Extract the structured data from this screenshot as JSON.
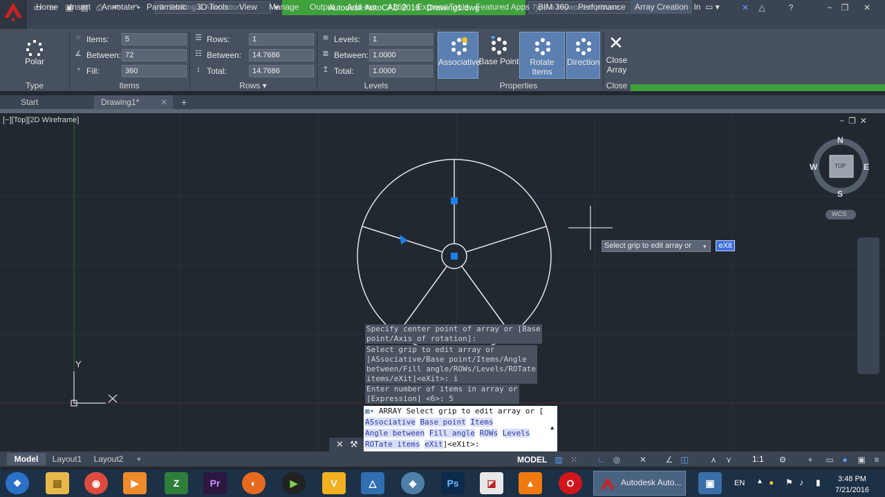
{
  "title_bar": {
    "workspace": "Drafting & Annotation",
    "app_title": "Autodesk AutoCAD 2016",
    "file_name": "Drawing1.dwg",
    "search_placeholder": "Type a keyword or phrase",
    "sign_in": "Sign In"
  },
  "ribbon_tabs": [
    "Home",
    "Insert",
    "Annotate",
    "Parametric",
    "3D Tools",
    "View",
    "Manage",
    "Output",
    "Add-ins",
    "A360",
    "Express Tools",
    "Featured Apps",
    "BIM 360",
    "Performance",
    "Array Creation"
  ],
  "ribbon": {
    "type_panel": {
      "title": "Type",
      "button": "Polar"
    },
    "items_panel": {
      "title": "Items",
      "fields": [
        {
          "label": "Items:",
          "value": "5"
        },
        {
          "label": "Between:",
          "value": "72"
        },
        {
          "label": "Fill:",
          "value": "360"
        }
      ]
    },
    "rows_panel": {
      "title": "Rows",
      "fields": [
        {
          "label": "Rows:",
          "value": "1"
        },
        {
          "label": "Between:",
          "value": "14.7686"
        },
        {
          "label": "Total:",
          "value": "14.7686"
        }
      ]
    },
    "levels_panel": {
      "title": "Levels",
      "fields": [
        {
          "label": "Levels:",
          "value": "1"
        },
        {
          "label": "Between:",
          "value": "1.0000"
        },
        {
          "label": "Total:",
          "value": "1.0000"
        }
      ]
    },
    "properties_panel": {
      "title": "Properties",
      "buttons": [
        "Associative",
        "Base Point",
        "Rotate Items",
        "Direction"
      ]
    },
    "close_panel": {
      "title": "Close",
      "button_line1": "Close",
      "button_line2": "Array"
    }
  },
  "file_tabs": {
    "start": "Start",
    "drawing": "Drawing1*"
  },
  "viewport": {
    "label": "[−][Top][2D Wireframe]",
    "viewcube": {
      "n": "N",
      "s": "S",
      "e": "E",
      "w": "W",
      "face": "TOP",
      "wcs": "WCS"
    },
    "ucs": {
      "y": "Y"
    }
  },
  "tooltip": {
    "text": "Select grip to edit array or",
    "option": "eXit"
  },
  "command_history": [
    "Specify center point of array or [Base\npoint/Axis of rotation]:",
    "Select grip to edit array or\n[ASsociative/Base point/Items/Angle\nbetween/Fill angle/ROWs/Levels/ROTate\nitems/eXit]<eXit>: i",
    "Enter number of items in array or\n[Expression] <6>: 5"
  ],
  "command_line": {
    "prefix": "ARRAY Select grip to edit array or [",
    "options_row1": [
      "ASsociative",
      "Base point",
      "Items"
    ],
    "options_row2": [
      "Angle between",
      "Fill angle",
      "ROWs",
      "Levels"
    ],
    "options_row3": [
      "ROTate items",
      "eXit"
    ],
    "suffix": "]<eXit>:"
  },
  "layout_tabs": [
    "Model",
    "Layout1",
    "Layout2"
  ],
  "status_bar": {
    "model": "MODEL",
    "scale": "1:1"
  },
  "taskbar": {
    "active_app": "Autodesk Auto...",
    "lang": "EN",
    "time": "3:48 PM",
    "date": "7/21/2016"
  },
  "colors": {
    "accent_green": "#3ea13c",
    "ribbon_bg": "#46505f",
    "canvas_bg": "#212830",
    "grip_blue": "#1e7fe8"
  }
}
